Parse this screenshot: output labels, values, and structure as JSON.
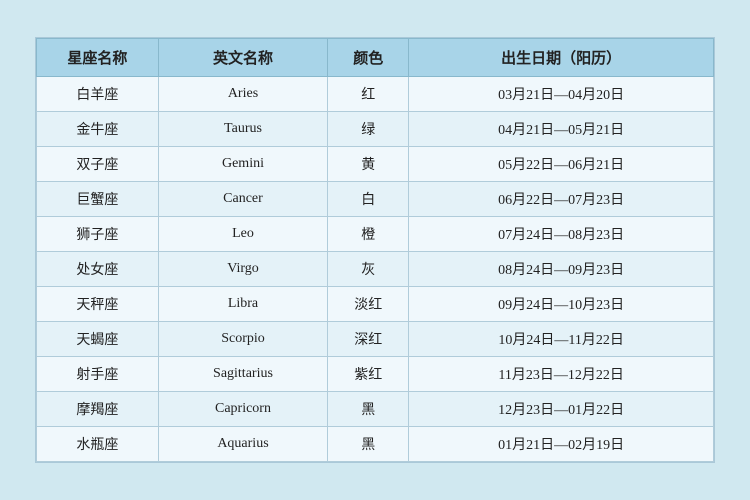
{
  "table": {
    "headers": [
      "星座名称",
      "英文名称",
      "颜色",
      "出生日期（阳历）"
    ],
    "rows": [
      {
        "zh": "白羊座",
        "en": "Aries",
        "color": "红",
        "date": "03月21日—04月20日"
      },
      {
        "zh": "金牛座",
        "en": "Taurus",
        "color": "绿",
        "date": "04月21日—05月21日"
      },
      {
        "zh": "双子座",
        "en": "Gemini",
        "color": "黄",
        "date": "05月22日—06月21日"
      },
      {
        "zh": "巨蟹座",
        "en": "Cancer",
        "color": "白",
        "date": "06月22日—07月23日"
      },
      {
        "zh": "狮子座",
        "en": "Leo",
        "color": "橙",
        "date": "07月24日—08月23日"
      },
      {
        "zh": "处女座",
        "en": "Virgo",
        "color": "灰",
        "date": "08月24日—09月23日"
      },
      {
        "zh": "天秤座",
        "en": "Libra",
        "color": "淡红",
        "date": "09月24日—10月23日"
      },
      {
        "zh": "天蝎座",
        "en": "Scorpio",
        "color": "深红",
        "date": "10月24日—11月22日"
      },
      {
        "zh": "射手座",
        "en": "Sagittarius",
        "color": "紫红",
        "date": "11月23日—12月22日"
      },
      {
        "zh": "摩羯座",
        "en": "Capricorn",
        "color": "黑",
        "date": "12月23日—01月22日"
      },
      {
        "zh": "水瓶座",
        "en": "Aquarius",
        "color": "黑",
        "date": "01月21日—02月19日"
      }
    ]
  }
}
